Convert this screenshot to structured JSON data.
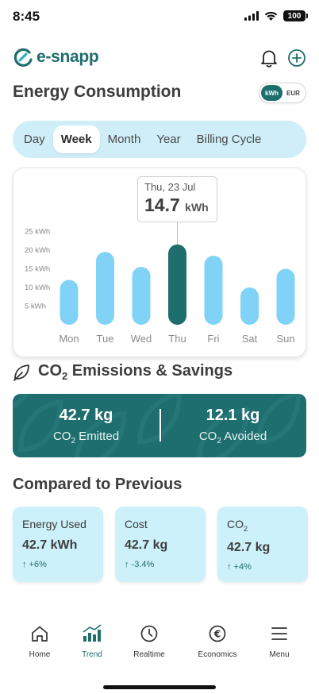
{
  "status_bar": {
    "time": "8:45",
    "battery": "100"
  },
  "app": {
    "logo_text": "e-snapp"
  },
  "page": {
    "title": "Energy Consumption"
  },
  "unit_toggle": {
    "options": [
      "kWh",
      "EUR"
    ],
    "selected": "kWh"
  },
  "period_tabs": {
    "items": [
      "Day",
      "Week",
      "Month",
      "Year",
      "Billing Cycle"
    ],
    "selected": "Week"
  },
  "chart_data": {
    "type": "bar",
    "categories": [
      "Mon",
      "Tue",
      "Wed",
      "Thu",
      "Fri",
      "Sat",
      "Sun"
    ],
    "values": [
      12,
      19.5,
      15.5,
      21.5,
      18.5,
      10,
      15
    ],
    "highlighted": "Thu",
    "yticks": [
      "5 kWh",
      "10 kWh",
      "15 kWh",
      "20 kWh",
      "25 kWh"
    ],
    "ylim": [
      0,
      27
    ],
    "grid": false,
    "colors": {
      "bar": "#80d3f7",
      "highlight": "#1f6e6e"
    },
    "tooltip": {
      "date": "Thu, 23 Jul",
      "value": "14.7",
      "unit": "kWh"
    }
  },
  "co2": {
    "title_main": "CO",
    "title_sub": "2",
    "title_rest": " Emissions & Savings",
    "emitted": {
      "value": "42.7 kg",
      "label_main": "CO",
      "label_sub": "2",
      "label_rest": " Emitted"
    },
    "avoided": {
      "value": "12.1 kg",
      "label_main": "CO",
      "label_sub": "2",
      "label_rest": " Avoided"
    }
  },
  "compare": {
    "title": "Compared to Previous",
    "cards": [
      {
        "label": "Energy Used",
        "value": "42.7 kWh",
        "change": "↑  +6%"
      },
      {
        "label": "Cost",
        "value": "42.7 kg",
        "change": "↑  -3.4%"
      },
      {
        "label_main": "CO",
        "label_sub": "2",
        "value": "42.7 kg",
        "change": "↑  +4%"
      }
    ]
  },
  "bottom_nav": {
    "items": [
      {
        "label": "Home",
        "icon": "home-icon"
      },
      {
        "label": "Trend",
        "icon": "trend-icon"
      },
      {
        "label": "Realtime",
        "icon": "clock-icon"
      },
      {
        "label": "Economics",
        "icon": "euro-icon"
      },
      {
        "label": "Menu",
        "icon": "menu-icon"
      }
    ],
    "selected": "Trend"
  },
  "colors": {
    "brand": "#1f6e6e",
    "light_blue": "#cfeef8",
    "bar": "#80d3f7"
  }
}
